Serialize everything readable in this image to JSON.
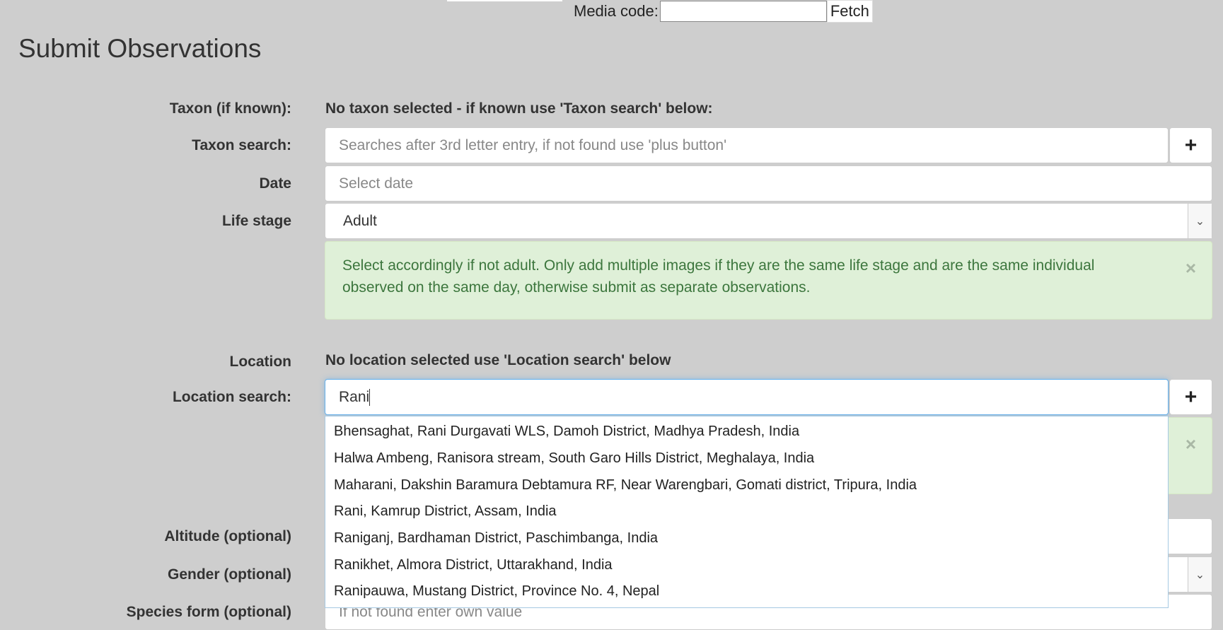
{
  "media": {
    "label": "Media code:",
    "fetch_label": "Fetch"
  },
  "page_title": "Submit Observations",
  "form": {
    "taxon_known": {
      "label": "Taxon (if known):",
      "status": "No taxon selected - if known use 'Taxon search' below:"
    },
    "taxon_search": {
      "label": "Taxon search:",
      "placeholder": "Searches after 3rd letter entry, if not found use 'plus button'",
      "plus": "+"
    },
    "date": {
      "label": "Date",
      "placeholder": "Select date"
    },
    "life_stage": {
      "label": "Life stage",
      "value": "Adult",
      "arrow": "⌄"
    },
    "life_stage_alert": {
      "text": "Select accordingly if not adult. Only add multiple images if they are the same life stage and are the same individual observed on the same day, otherwise submit as separate observations.",
      "close": "×"
    },
    "location": {
      "label": "Location",
      "status": "No location selected use 'Location search' below"
    },
    "location_search": {
      "label": "Location search:",
      "value": "Rani",
      "plus": "+"
    },
    "location_alert": {
      "close": "×"
    },
    "altitude": {
      "label": "Altitude (optional)"
    },
    "gender": {
      "label": "Gender (optional)",
      "arrow": "⌄"
    },
    "species_form": {
      "label": "Species form (optional)",
      "placeholder": "If not found enter own value"
    }
  },
  "location_suggestions": [
    "Bhensaghat, Rani Durgavati WLS, Damoh District, Madhya Pradesh, India",
    "Halwa Ambeng, Ranisora stream, South Garo Hills District, Meghalaya, India",
    "Maharani, Dakshin Baramura Debtamura RF, Near Warengbari, Gomati district, Tripura, India",
    "Rani, Kamrup District, Assam, India",
    "Raniganj, Bardhaman District, Paschimbanga, India",
    "Ranikhet, Almora District, Uttarakhand, India",
    "Ranipauwa, Mustang District, Province No. 4, Nepal"
  ]
}
